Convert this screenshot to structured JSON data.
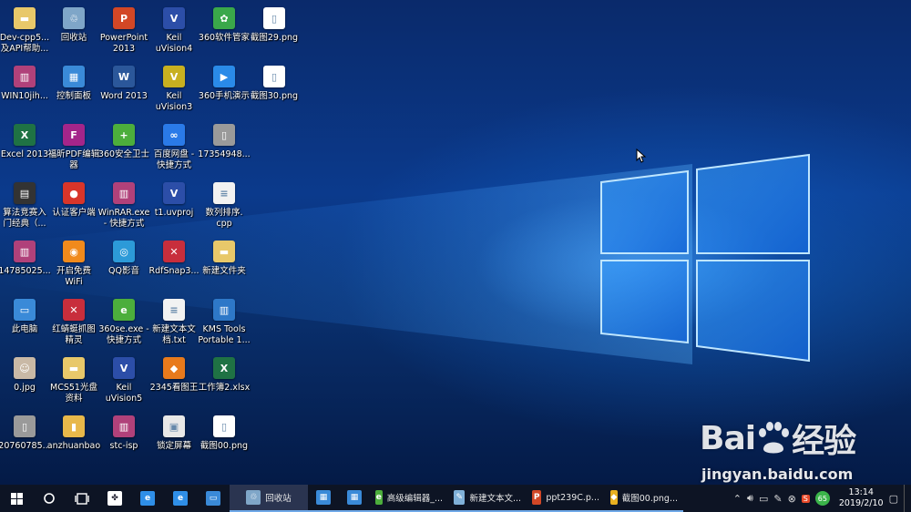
{
  "desktop": {
    "icons": [
      {
        "label": "Dev-cpp5...\n及API帮助...",
        "icon": "folder-icon",
        "color": "#e8c86a"
      },
      {
        "label": "WIN10jih...",
        "icon": "winrar-icon",
        "color": "#b0417a"
      },
      {
        "label": "Excel 2013",
        "icon": "excel-icon",
        "color": "#1f7244"
      },
      {
        "label": "算法竞赛入\n门经典（...",
        "icon": "book-icon",
        "color": "#333333"
      },
      {
        "label": "14785025...",
        "icon": "winrar-icon",
        "color": "#b0417a"
      },
      {
        "label": "此电脑",
        "icon": "computer-icon",
        "color": "#3a8ad8"
      },
      {
        "label": "0.jpg",
        "icon": "photo-icon",
        "color": "#c9b9a6"
      },
      {
        "label": "20760785...",
        "icon": "image-file-icon",
        "color": "#9a9a9a"
      },
      {
        "label": "回收站",
        "icon": "recycle-bin-icon",
        "color": "#7fa6c8"
      },
      {
        "label": "控制面板",
        "icon": "control-panel-icon",
        "color": "#3a8ad8"
      },
      {
        "label": "福昕PDF编辑\n器",
        "icon": "foxit-icon",
        "color": "#a4258a"
      },
      {
        "label": "认证客户端",
        "icon": "client-icon",
        "color": "#d8352a"
      },
      {
        "label": "开启免费\nWiFi",
        "icon": "wifi-icon",
        "color": "#f08a1c"
      },
      {
        "label": "红蜻蜓抓图\n精灵",
        "icon": "dragonfly-icon",
        "color": "#c82e3c"
      },
      {
        "label": "MCS51光盘\n资料",
        "icon": "folder-icon",
        "color": "#e8c86a"
      },
      {
        "label": "anzhuanbao",
        "icon": "archive-icon",
        "color": "#e8b84a"
      },
      {
        "label": "PowerPoint\n2013",
        "icon": "powerpoint-icon",
        "color": "#d24726"
      },
      {
        "label": "Word 2013",
        "icon": "word-icon",
        "color": "#2b579a"
      },
      {
        "label": "360安全卫士",
        "icon": "360-safe-icon",
        "color": "#4cae3c"
      },
      {
        "label": "WinRAR.exe\n- 快捷方式",
        "icon": "winrar-icon",
        "color": "#b0417a"
      },
      {
        "label": "QQ影音",
        "icon": "qq-player-icon",
        "color": "#2c9ad8"
      },
      {
        "label": "360se.exe -\n快捷方式",
        "icon": "360-browser-icon",
        "color": "#4cae3c"
      },
      {
        "label": "Keil\nuVision5",
        "icon": "keil-icon",
        "color": "#2c4ea8"
      },
      {
        "label": "stc-isp",
        "icon": "winrar-icon",
        "color": "#b0417a"
      },
      {
        "label": "Keil\nuVision4",
        "icon": "keil-icon",
        "color": "#2c4ea8"
      },
      {
        "label": "Keil\nuVision3",
        "icon": "keil-icon",
        "color": "#c8b020"
      },
      {
        "label": "百度网盘 -\n快捷方式",
        "icon": "baidu-disk-icon",
        "color": "#2a7ae8"
      },
      {
        "label": "t1.uvproj",
        "icon": "keil-icon",
        "color": "#2c4ea8"
      },
      {
        "label": "RdfSnap3...",
        "icon": "dragonfly-icon",
        "color": "#c82e3c"
      },
      {
        "label": "新建文本文\n档.txt",
        "icon": "text-file-icon",
        "color": "#f2f2f2"
      },
      {
        "label": "2345看图王",
        "icon": "2345-viewer-icon",
        "color": "#e87a1c"
      },
      {
        "label": "锁定屏幕",
        "icon": "lock-screen-icon",
        "color": "#e8e8e8"
      },
      {
        "label": "360软件管家",
        "icon": "360-software-icon",
        "color": "#3aa84a"
      },
      {
        "label": "360手机演示",
        "icon": "360-phone-icon",
        "color": "#2a8ae8"
      },
      {
        "label": "17354948...",
        "icon": "image-file-icon",
        "color": "#9a9a9a"
      },
      {
        "label": "数列排序.\ncpp",
        "icon": "text-file-icon",
        "color": "#f2f2f2"
      },
      {
        "label": "新建文件夹",
        "icon": "folder-icon",
        "color": "#e8c86a"
      },
      {
        "label": "KMS Tools\nPortable 1...",
        "icon": "winrar-icon",
        "color": "#2e78c8"
      },
      {
        "label": "工作簿2.xlsx",
        "icon": "excel-icon",
        "color": "#1f7244"
      },
      {
        "label": "截图00.png",
        "icon": "image-file-icon",
        "color": "#ffffff"
      },
      {
        "label": "截图29.png",
        "icon": "image-file-icon",
        "color": "#ffffff"
      },
      {
        "label": "截图30.png",
        "icon": "image-file-icon",
        "color": "#ffffff"
      }
    ]
  },
  "taskbar": {
    "start": "start-icon",
    "search": "search-icon",
    "task_view": "task-view-icon",
    "pinned": [
      {
        "name": "fan-app",
        "icon": "fan-icon",
        "color": "#ffffff"
      },
      {
        "name": "ie",
        "icon": "ie-icon",
        "color": "#2f8fe8"
      },
      {
        "name": "edge",
        "icon": "edge-icon",
        "color": "#2f8fe8"
      },
      {
        "name": "computer",
        "icon": "computer-icon",
        "color": "#3a8ad8"
      }
    ],
    "apps": [
      {
        "label": "回收站",
        "icon": "recycle-bin-icon",
        "color": "#7fa6c8",
        "active": true
      },
      {
        "label": "",
        "icon": "store-icon",
        "color": "#3a8ad8",
        "active": false
      },
      {
        "label": "",
        "icon": "control-panel-icon",
        "color": "#3a8ad8",
        "active": false
      },
      {
        "label": "高级编辑器_...",
        "icon": "browser-icon",
        "color": "#4cae3c",
        "active": false
      },
      {
        "label": "新建文本文...",
        "icon": "notepad-icon",
        "color": "#7fb0d8",
        "active": false
      },
      {
        "label": "ppt239C.p...",
        "icon": "powerpoint-icon",
        "color": "#d24726",
        "active": false
      },
      {
        "label": "截图00.png...",
        "icon": "2345-viewer-icon",
        "color": "#e8b020",
        "active": false
      }
    ],
    "tray": {
      "badge": "65",
      "time": "13:14",
      "date": "2019/2/10"
    }
  },
  "watermark": {
    "brand_left": "Bai",
    "brand_right": "经验",
    "url": "jingyan.baidu.com"
  }
}
